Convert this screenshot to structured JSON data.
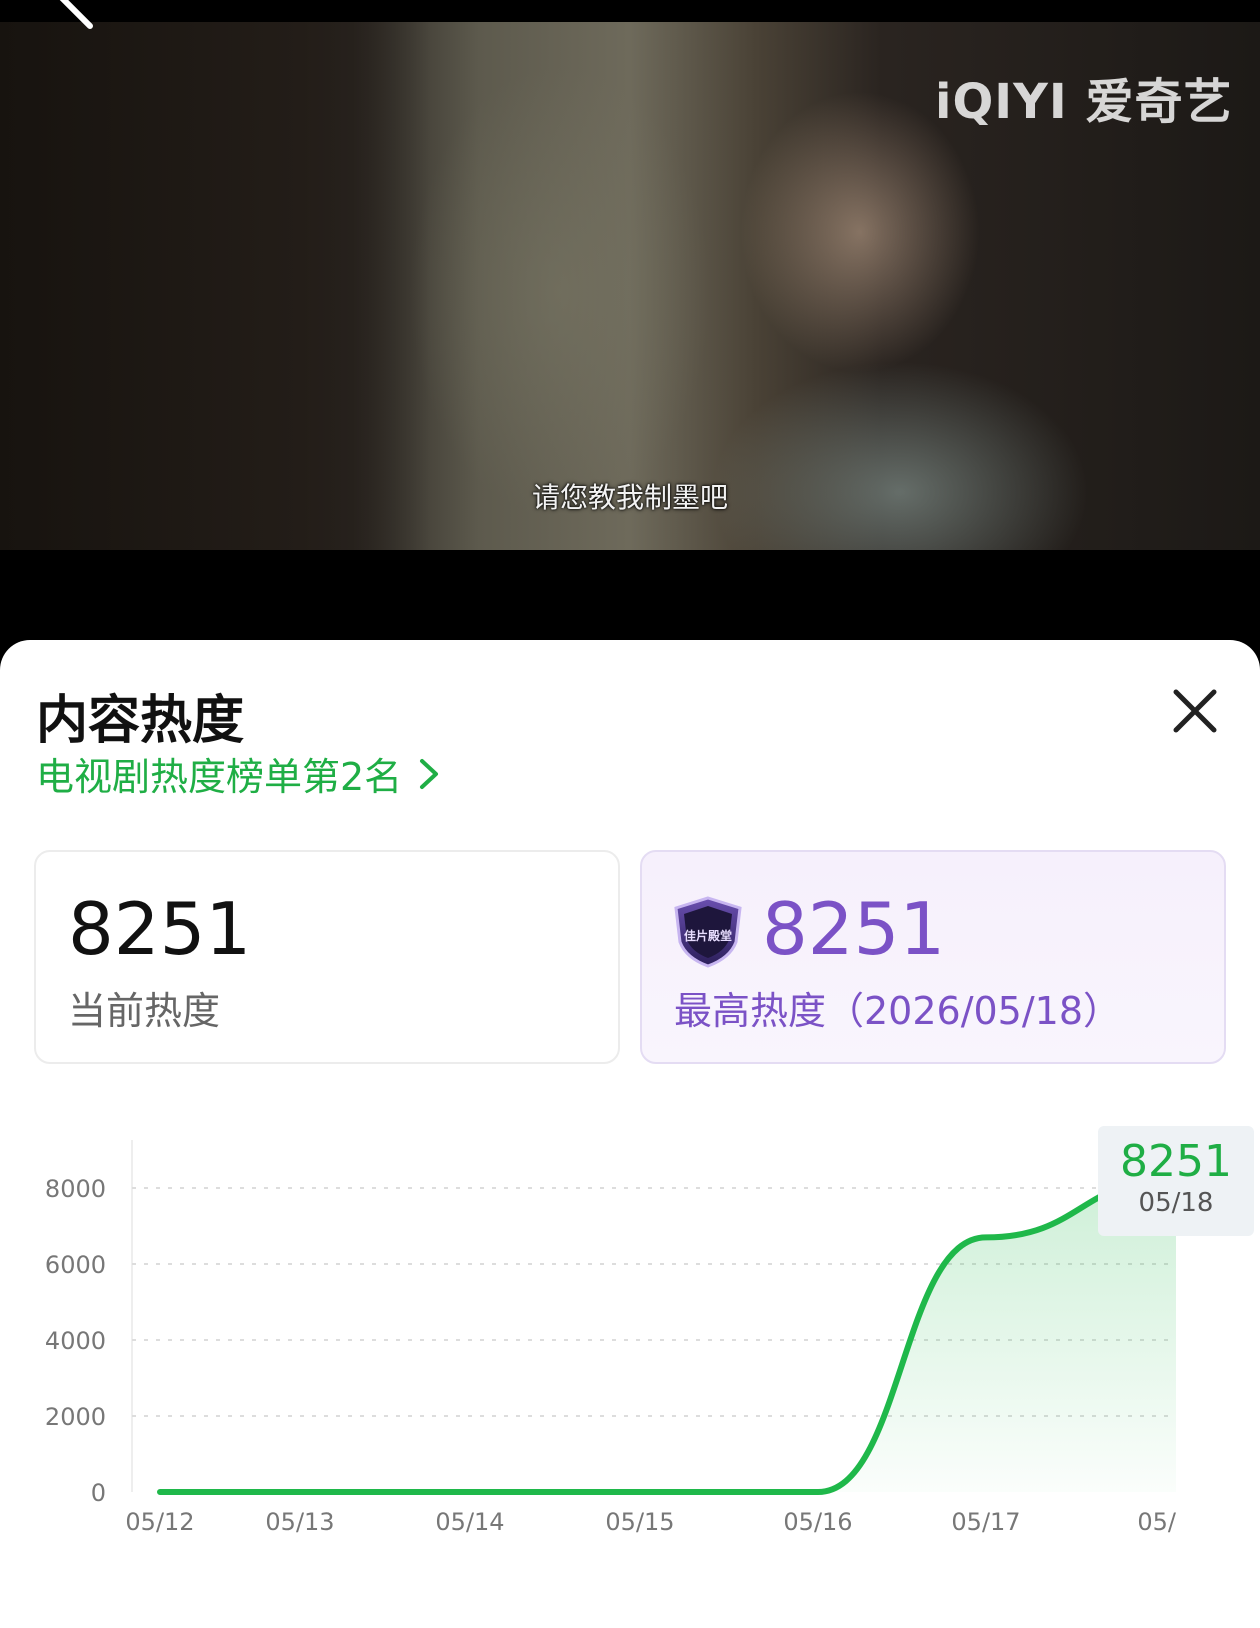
{
  "video": {
    "logo": "iQIYI 爱奇艺",
    "subtitle": "请您教我制墨吧"
  },
  "panel": {
    "title": "内容热度",
    "rank_link": "电视剧热度榜单第2名",
    "current": {
      "value": "8251",
      "label": "当前热度"
    },
    "peak": {
      "value": "8251",
      "label": "最高热度（2026/05/18）",
      "badge": "佳片殿堂"
    }
  },
  "tooltip": {
    "value": "8251",
    "date": "05/18"
  },
  "chart_data": {
    "type": "area",
    "title": "",
    "xlabel": "",
    "ylabel": "",
    "categories": [
      "05/12",
      "05/13",
      "05/14",
      "05/15",
      "05/16",
      "05/17",
      "05/18"
    ],
    "x_tick_labels": [
      "05/12",
      "05/13",
      "05/14",
      "05/15",
      "05/16",
      "05/17",
      "05/"
    ],
    "y_ticks": [
      "0",
      "2000",
      "4000",
      "6000",
      "8000"
    ],
    "ylim": [
      0,
      9000
    ],
    "grid": true,
    "series": [
      {
        "values": [
          0,
          0,
          0,
          0,
          0,
          6700,
          8251
        ],
        "color": "#1fb84a"
      }
    ],
    "highlight": {
      "category": "05/18",
      "value": 8251
    }
  }
}
